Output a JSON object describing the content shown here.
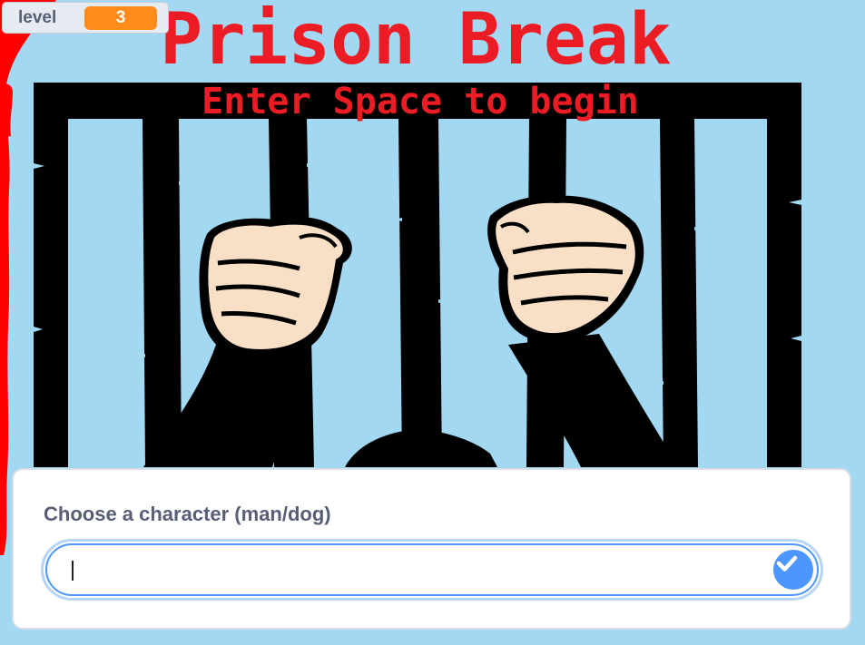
{
  "game": {
    "title": "Prison Break",
    "subtitle": "Enter Space to begin"
  },
  "variable_monitor": {
    "name": "level",
    "value": "3"
  },
  "ask_prompt": {
    "question": "Choose a character (man/dog)",
    "input_value": "",
    "submit_icon": "check-icon"
  },
  "colors": {
    "stage_background": "#a3d8f2",
    "title_red": "#ec1c24",
    "paint_red": "#ff0000",
    "bars_black": "#000000",
    "skin": "#f8dfc6",
    "variable_orange": "#ff8c1a",
    "scratch_blue": "#4c97ff"
  }
}
